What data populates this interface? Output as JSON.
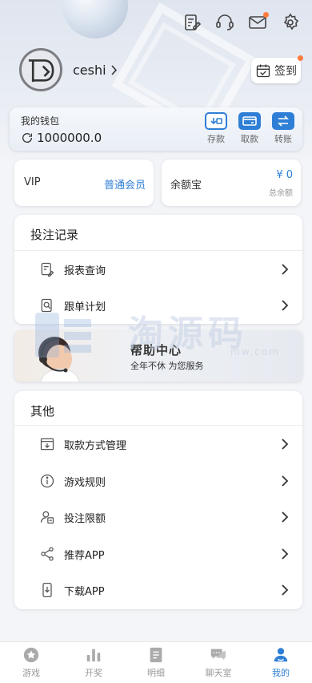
{
  "header": {
    "username": "ceshi",
    "signin_label": "签到"
  },
  "wallet": {
    "title": "我的钱包",
    "balance": "1000000.0",
    "actions": [
      {
        "label": "存款",
        "icon": "deposit-icon"
      },
      {
        "label": "取款",
        "icon": "withdraw-icon"
      },
      {
        "label": "转账",
        "icon": "transfer-icon"
      }
    ]
  },
  "vip": {
    "label": "VIP",
    "level": "普通会员"
  },
  "yeb": {
    "label": "余额宝",
    "amount": "¥ 0",
    "sub": "总余额"
  },
  "bet_section": {
    "title": "投注记录",
    "items": [
      {
        "label": "报表查询",
        "icon": "report-icon"
      },
      {
        "label": "跟单计划",
        "icon": "follow-plan-icon"
      }
    ]
  },
  "help": {
    "title": "帮助中心",
    "subtitle": "全年不休 为您服务"
  },
  "watermark": {
    "text": "淘源码",
    "url": "mw.com"
  },
  "other_section": {
    "title": "其他",
    "items": [
      {
        "label": "取款方式管理",
        "icon": "withdraw-method-icon"
      },
      {
        "label": "游戏规则",
        "icon": "info-icon"
      },
      {
        "label": "投注限额",
        "icon": "bet-limit-icon"
      },
      {
        "label": "推荐APP",
        "icon": "share-icon"
      },
      {
        "label": "下载APP",
        "icon": "download-icon"
      }
    ]
  },
  "tabbar": [
    {
      "label": "游戏",
      "icon": "game-icon",
      "active": false
    },
    {
      "label": "开奖",
      "icon": "lottery-results-icon",
      "active": false
    },
    {
      "label": "明细",
      "icon": "details-icon",
      "active": false
    },
    {
      "label": "聊天室",
      "icon": "chat-icon",
      "active": false
    },
    {
      "label": "我的",
      "icon": "profile-icon",
      "active": true
    }
  ],
  "colors": {
    "accent": "#2f7fd6",
    "badge": "#ff7a3d",
    "background": "#f4f5f8"
  }
}
